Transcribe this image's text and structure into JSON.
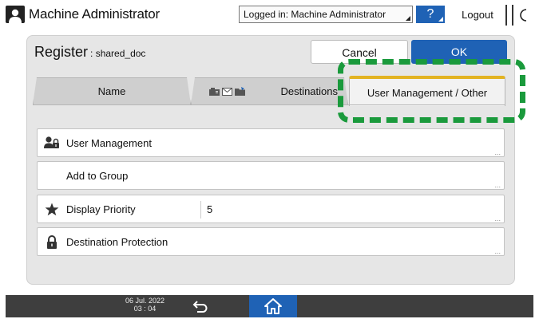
{
  "header": {
    "title": "Machine Administrator",
    "logged_in": "Logged in: Machine Administrator",
    "help_label": "?",
    "logout_label": "Logout",
    "icons": {
      "user": "user-icon",
      "night_mode": "moon-icon"
    }
  },
  "dialog": {
    "title": "Register",
    "subtitle": ": shared_doc",
    "cancel_label": "Cancel",
    "ok_label": "OK",
    "tabs": [
      {
        "label": "Name",
        "selected": false
      },
      {
        "label": "Destinations",
        "selected": false,
        "icons": [
          "fax-icon",
          "mail-icon",
          "folder-icon"
        ]
      },
      {
        "label": "User Management / Other",
        "selected": true
      }
    ],
    "rows": [
      {
        "label": "User Management",
        "icon": "user-lock-icon",
        "value": ""
      },
      {
        "label": "Add to Group",
        "icon": "",
        "value": ""
      },
      {
        "label": "Display Priority",
        "icon": "star-icon",
        "value": "5"
      },
      {
        "label": "Destination Protection",
        "icon": "lock-icon",
        "value": ""
      }
    ],
    "more_indicator": "...",
    "highlight_color": "#1a9a3c",
    "selected_tab_accent": "#e2b322"
  },
  "footer": {
    "date": "06 Jul. 2022",
    "time": "03 : 04",
    "icons": {
      "back": "back-arrow-icon",
      "home": "home-icon"
    }
  },
  "colors": {
    "primary": "#1f62b5",
    "footer_bg": "#3e3e3e"
  }
}
